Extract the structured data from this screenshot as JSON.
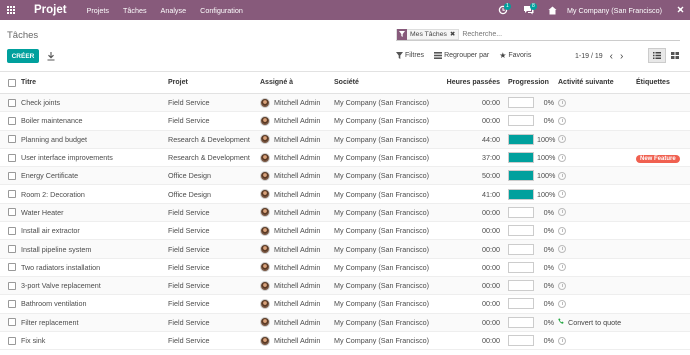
{
  "navbar": {
    "app_title": "Projet",
    "menu": [
      "Projets",
      "Tâches",
      "Analyse",
      "Configuration"
    ],
    "activity_count": "1",
    "message_count": "8",
    "company": "My Company (San Francisco)"
  },
  "control": {
    "breadcrumb": "Tâches",
    "facet_label": "Mes Tâches",
    "search_placeholder": "Recherche...",
    "create_label": "CRÉER",
    "filters_label": "Filtres",
    "groupby_label": "Regrouper par",
    "favorites_label": "Favoris",
    "pager": "1-19 / 19"
  },
  "table": {
    "headers": {
      "title": "Titre",
      "project": "Projet",
      "assigned": "Assigné à",
      "company": "Société",
      "hours": "Heures passées",
      "progress": "Progression",
      "activity": "Activité suivante",
      "tags": "Étiquettes"
    },
    "rows": [
      {
        "title": "Check joints",
        "project": "Field Service",
        "assigned": "Mitchell Admin",
        "company": "My Company (San Francisco)",
        "hours": "00:00",
        "progress": 0,
        "progress_text": "0%",
        "activity": "",
        "tag": ""
      },
      {
        "title": "Boiler maintenance",
        "project": "Field Service",
        "assigned": "Mitchell Admin",
        "company": "My Company (San Francisco)",
        "hours": "00:00",
        "progress": 0,
        "progress_text": "0%",
        "activity": "",
        "tag": ""
      },
      {
        "title": "Planning and budget",
        "project": "Research & Development",
        "assigned": "Mitchell Admin",
        "company": "My Company (San Francisco)",
        "hours": "44:00",
        "progress": 100,
        "progress_text": "100%",
        "activity": "",
        "tag": ""
      },
      {
        "title": "User interface improvements",
        "project": "Research & Development",
        "assigned": "Mitchell Admin",
        "company": "My Company (San Francisco)",
        "hours": "37:00",
        "progress": 100,
        "progress_text": "100%",
        "activity": "",
        "tag": "New Feature"
      },
      {
        "title": "Energy Certificate",
        "project": "Office Design",
        "assigned": "Mitchell Admin",
        "company": "My Company (San Francisco)",
        "hours": "50:00",
        "progress": 100,
        "progress_text": "100%",
        "activity": "",
        "tag": ""
      },
      {
        "title": "Room 2: Decoration",
        "project": "Office Design",
        "assigned": "Mitchell Admin",
        "company": "My Company (San Francisco)",
        "hours": "41:00",
        "progress": 100,
        "progress_text": "100%",
        "activity": "",
        "tag": ""
      },
      {
        "title": "Water Heater",
        "project": "Field Service",
        "assigned": "Mitchell Admin",
        "company": "My Company (San Francisco)",
        "hours": "00:00",
        "progress": 0,
        "progress_text": "0%",
        "activity": "",
        "tag": ""
      },
      {
        "title": "Install air extractor",
        "project": "Field Service",
        "assigned": "Mitchell Admin",
        "company": "My Company (San Francisco)",
        "hours": "00:00",
        "progress": 0,
        "progress_text": "0%",
        "activity": "",
        "tag": ""
      },
      {
        "title": "Install pipeline system",
        "project": "Field Service",
        "assigned": "Mitchell Admin",
        "company": "My Company (San Francisco)",
        "hours": "00:00",
        "progress": 0,
        "progress_text": "0%",
        "activity": "",
        "tag": ""
      },
      {
        "title": "Two radiators installation",
        "project": "Field Service",
        "assigned": "Mitchell Admin",
        "company": "My Company (San Francisco)",
        "hours": "00:00",
        "progress": 0,
        "progress_text": "0%",
        "activity": "",
        "tag": ""
      },
      {
        "title": "3-port Valve replacement",
        "project": "Field Service",
        "assigned": "Mitchell Admin",
        "company": "My Company (San Francisco)",
        "hours": "00:00",
        "progress": 0,
        "progress_text": "0%",
        "activity": "",
        "tag": ""
      },
      {
        "title": "Bathroom ventilation",
        "project": "Field Service",
        "assigned": "Mitchell Admin",
        "company": "My Company (San Francisco)",
        "hours": "00:00",
        "progress": 0,
        "progress_text": "0%",
        "activity": "",
        "tag": ""
      },
      {
        "title": "Filter replacement",
        "project": "Field Service",
        "assigned": "Mitchell Admin",
        "company": "My Company (San Francisco)",
        "hours": "00:00",
        "progress": 0,
        "progress_text": "0%",
        "activity": "Convert to quote",
        "tag": ""
      },
      {
        "title": "Fix sink",
        "project": "Field Service",
        "assigned": "Mitchell Admin",
        "company": "My Company (San Francisco)",
        "hours": "00:00",
        "progress": 0,
        "progress_text": "0%",
        "activity": "",
        "tag": ""
      }
    ]
  },
  "colors": {
    "navbar": "#875a7b",
    "accent": "#00a09d",
    "tag_new_feature": "#f06050",
    "activity_call": "#28a745"
  },
  "icons": [
    "apps-icon",
    "activity-icon",
    "chat-icon",
    "company-icon",
    "debug-icon",
    "filter-icon",
    "close-icon",
    "download-icon",
    "filters-icon",
    "groupby-icon",
    "star-icon",
    "chevron-left-icon",
    "chevron-right-icon",
    "list-view-icon",
    "kanban-view-icon",
    "clock-icon",
    "phone-icon"
  ]
}
